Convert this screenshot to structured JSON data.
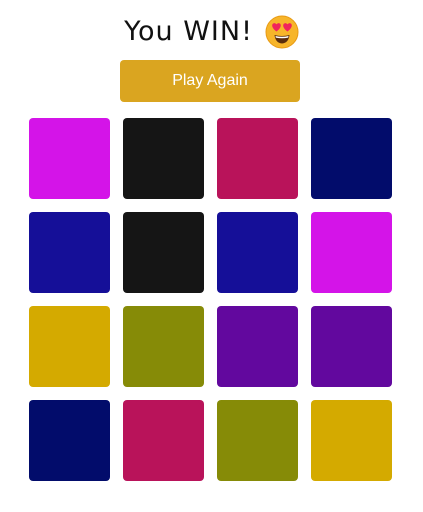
{
  "header": {
    "title": "You WIN!",
    "emoji_icon": "star-struck-face-icon"
  },
  "actions": {
    "play_again_label": "Play Again"
  },
  "colors": {
    "button_background": "#daa520",
    "button_text": "#ffffff"
  },
  "board": {
    "rows": 4,
    "columns": 4,
    "tiles": [
      {
        "color": "#d414e8"
      },
      {
        "color": "#151515"
      },
      {
        "color": "#b9135a"
      },
      {
        "color": "#020c6b"
      },
      {
        "color": "#150f98"
      },
      {
        "color": "#151515"
      },
      {
        "color": "#150f98"
      },
      {
        "color": "#d414e8"
      },
      {
        "color": "#d4aa00"
      },
      {
        "color": "#868b07"
      },
      {
        "color": "#62089e"
      },
      {
        "color": "#62089e"
      },
      {
        "color": "#020c6b"
      },
      {
        "color": "#b9135a"
      },
      {
        "color": "#868b07"
      },
      {
        "color": "#d4aa00"
      }
    ]
  }
}
